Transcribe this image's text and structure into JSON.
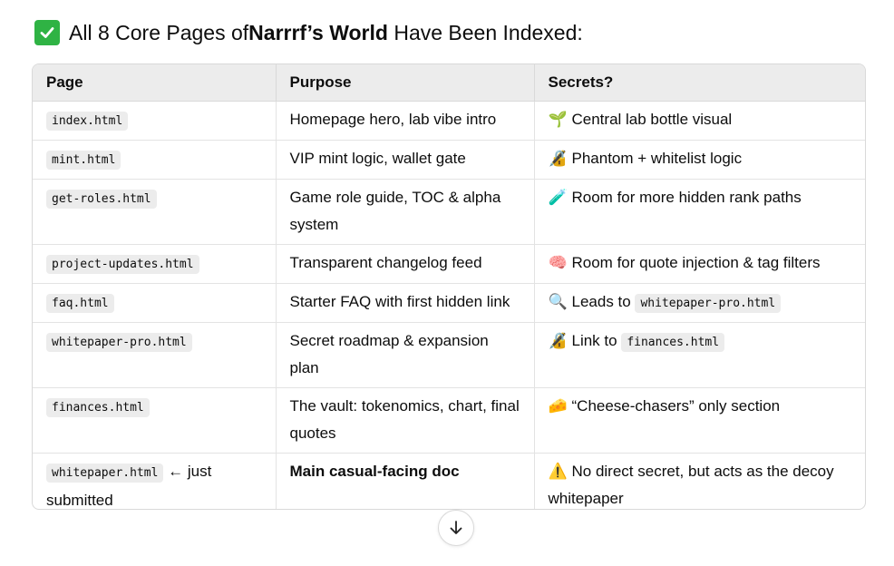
{
  "heading": {
    "prefix": "All 8 Core Pages of ",
    "bold": "Narrrf’s World",
    "suffix": " Have Been Indexed:",
    "icon": "check-mark-icon",
    "icon_color": "#2fb344"
  },
  "table": {
    "headers": [
      "Page",
      "Purpose",
      "Secrets?"
    ],
    "rows": [
      {
        "page": "index.html",
        "page_note": "",
        "purpose": "Homepage hero, lab vibe intro",
        "secret_icon": "seedling-icon",
        "secret_glyph": "🌱",
        "secret": "Central lab bottle visual",
        "secret_code": "",
        "secret_pre": ""
      },
      {
        "page": "mint.html",
        "page_note": "",
        "purpose": "VIP mint logic, wallet gate",
        "secret_icon": "lock-icon",
        "secret_glyph": "🔏",
        "secret": "Phantom + whitelist logic",
        "secret_code": "",
        "secret_pre": ""
      },
      {
        "page": "get-roles.html",
        "page_note": "",
        "purpose": "Game role guide, TOC & alpha system",
        "secret_icon": "test-tube-icon",
        "secret_glyph": "🧪",
        "secret": "Room for more hidden rank paths",
        "secret_code": "",
        "secret_pre": ""
      },
      {
        "page": "project-updates.html",
        "page_note": "",
        "purpose": "Transparent changelog feed",
        "secret_icon": "brain-icon",
        "secret_glyph": "🧠",
        "secret": "Room for quote injection & tag filters",
        "secret_code": "",
        "secret_pre": ""
      },
      {
        "page": "faq.html",
        "page_note": "",
        "purpose": "Starter FAQ with first hidden link",
        "secret_icon": "magnifier-icon",
        "secret_glyph": "🔍",
        "secret_pre": "Leads to ",
        "secret_code": "whitepaper-pro.html",
        "secret": ""
      },
      {
        "page": "whitepaper-pro.html",
        "page_note": "",
        "purpose": "Secret roadmap & expansion plan",
        "secret_icon": "lock-icon",
        "secret_glyph": "🔏",
        "secret_pre": "Link to ",
        "secret_code": "finances.html",
        "secret": ""
      },
      {
        "page": "finances.html",
        "page_note": "",
        "purpose": "The vault: tokenomics, chart, final quotes",
        "secret_icon": "cheese-icon",
        "secret_glyph": "🧀",
        "secret": "“Cheese-chasers” only section",
        "secret_code": "",
        "secret_pre": ""
      },
      {
        "page": "whitepaper.html",
        "page_note": " ← just submitted",
        "purpose": "Main casual-facing doc",
        "secret_icon": "warning-icon",
        "secret_glyph": "⚠️",
        "secret": "No direct secret, but acts as the decoy whitepaper",
        "secret_code": "",
        "secret_pre": ""
      }
    ]
  },
  "scroll_button": {
    "icon": "arrow-down-icon"
  }
}
